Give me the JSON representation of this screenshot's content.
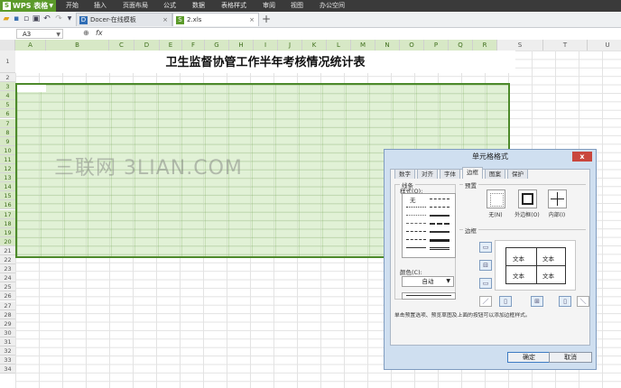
{
  "app": {
    "brand": "WPS 表格",
    "brand_icon": "S"
  },
  "menu": [
    "开始",
    "插入",
    "页面布局",
    "公式",
    "数据",
    "表格样式",
    "审阅",
    "视图",
    "办公空间"
  ],
  "tabs": [
    {
      "label": "Docer-在线模板",
      "icon": "D",
      "close": "×"
    },
    {
      "label": "2.xls",
      "icon": "S",
      "close": "×"
    }
  ],
  "add_tab": "+",
  "formula_bar": {
    "name_box": "A3",
    "fx": "fx",
    "zoom_icon": "⊕"
  },
  "columns": [
    "A",
    "B",
    "C",
    "D",
    "E",
    "F",
    "G",
    "H",
    "I",
    "J",
    "K",
    "L",
    "M",
    "N",
    "O",
    "P",
    "Q",
    "R",
    "S",
    "T",
    "U"
  ],
  "rows": [
    "1",
    "2",
    "3",
    "4",
    "5",
    "6",
    "7",
    "8",
    "9",
    "10",
    "11",
    "12",
    "13",
    "14",
    "15",
    "16",
    "17",
    "18",
    "19",
    "20",
    "21",
    "22",
    "23",
    "24",
    "25",
    "26",
    "27",
    "28",
    "29",
    "30",
    "31",
    "32",
    "33",
    "34"
  ],
  "sheet": {
    "title": "卫生监督协管工作半年考核情况统计表"
  },
  "watermark": "三联网 3LIAN.COM",
  "dialog": {
    "title": "单元格格式",
    "close": "x",
    "tabs": [
      "数字",
      "对齐",
      "字体",
      "边框",
      "图案",
      "保护"
    ],
    "active_tab": "边框",
    "line_group": "线条",
    "style_label": "样式(O):",
    "style_none": "无",
    "color_label": "颜色(C):",
    "color_value": "自动",
    "preset_group": "预置",
    "presets": [
      "无(N)",
      "外边框(O)",
      "内部(I)"
    ],
    "border_group": "边框",
    "preview_text": [
      "文本",
      "文本",
      "文本",
      "文本"
    ],
    "hint": "单击预置选项、预览草图及上面的按钮可以添加边框样式。",
    "ok": "确定",
    "cancel": "取消"
  },
  "colors": {
    "accent": "#4d8a2b",
    "selection": "#d7e8c6",
    "menubar": "#3a3a3a"
  }
}
